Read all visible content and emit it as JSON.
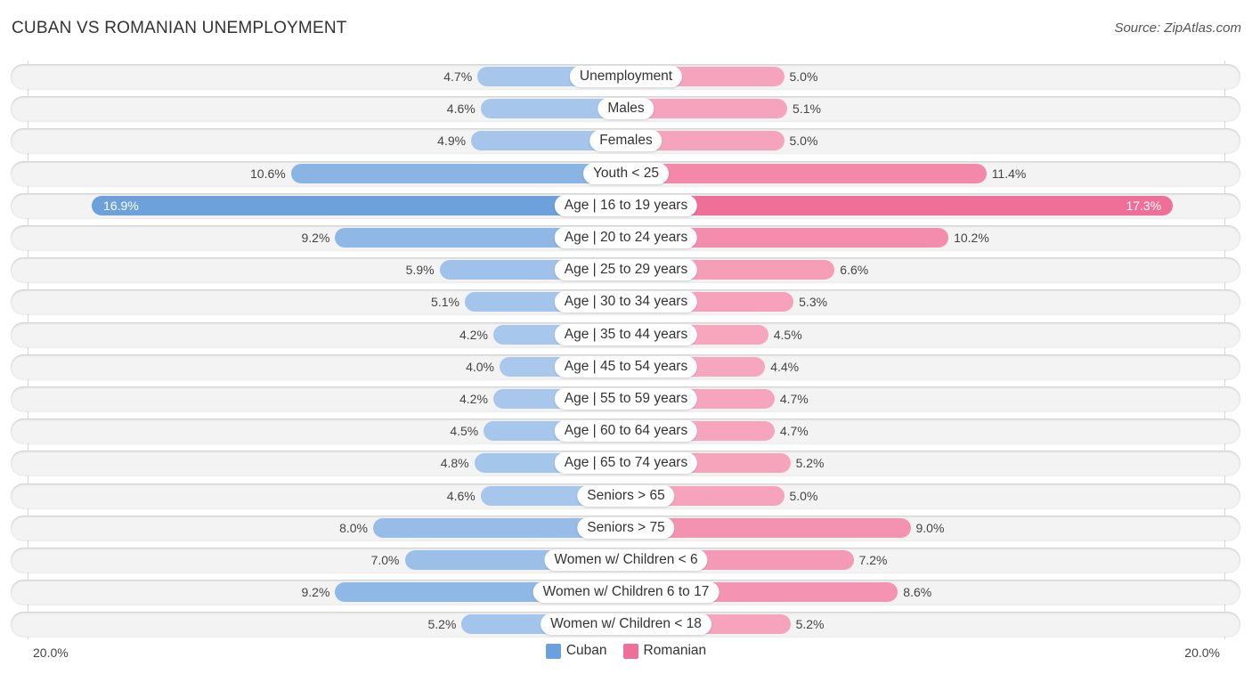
{
  "title": "CUBAN VS ROMANIAN UNEMPLOYMENT",
  "source": "Source: ZipAtlas.com",
  "legend": [
    {
      "name": "Cuban",
      "color": "#6aa0dc"
    },
    {
      "name": "Romanian",
      "color": "#f06f98"
    }
  ],
  "axis": {
    "left_label": "20.0%",
    "right_label": "20.0%"
  },
  "chart_data": {
    "type": "bar",
    "orientation": "horizontal-diverging",
    "title": "CUBAN VS ROMANIAN UNEMPLOYMENT",
    "xlabel": "",
    "ylabel": "",
    "xlim": [
      -20,
      20
    ],
    "unit": "%",
    "categories": [
      "Unemployment",
      "Males",
      "Females",
      "Youth < 25",
      "Age | 16 to 19 years",
      "Age | 20 to 24 years",
      "Age | 25 to 29 years",
      "Age | 30 to 34 years",
      "Age | 35 to 44 years",
      "Age | 45 to 54 years",
      "Age | 55 to 59 years",
      "Age | 60 to 64 years",
      "Age | 65 to 74 years",
      "Seniors > 65",
      "Seniors > 75",
      "Women w/ Children < 6",
      "Women w/ Children 6 to 17",
      "Women w/ Children < 18"
    ],
    "series": [
      {
        "name": "Cuban",
        "color": "#6aa0dc",
        "values": [
          4.7,
          4.6,
          4.9,
          10.6,
          16.9,
          9.2,
          5.9,
          5.1,
          4.2,
          4.0,
          4.2,
          4.5,
          4.8,
          4.6,
          8.0,
          7.0,
          9.2,
          5.2
        ],
        "labels": [
          "4.7%",
          "4.6%",
          "4.9%",
          "10.6%",
          "16.9%",
          "9.2%",
          "5.9%",
          "5.1%",
          "4.2%",
          "4.0%",
          "4.2%",
          "4.5%",
          "4.8%",
          "4.6%",
          "8.0%",
          "7.0%",
          "9.2%",
          "5.2%"
        ]
      },
      {
        "name": "Romanian",
        "color": "#f06f98",
        "values": [
          5.0,
          5.1,
          5.0,
          11.4,
          17.3,
          10.2,
          6.6,
          5.3,
          4.5,
          4.4,
          4.7,
          4.7,
          5.2,
          5.0,
          9.0,
          7.2,
          8.6,
          5.2
        ],
        "labels": [
          "5.0%",
          "5.1%",
          "5.0%",
          "11.4%",
          "17.3%",
          "10.2%",
          "6.6%",
          "5.3%",
          "4.5%",
          "4.4%",
          "4.7%",
          "4.7%",
          "5.2%",
          "5.0%",
          "9.0%",
          "7.2%",
          "8.6%",
          "5.2%"
        ]
      }
    ],
    "legend": [
      "Cuban",
      "Romanian"
    ],
    "legend_position": "bottom-center",
    "grid": false
  }
}
